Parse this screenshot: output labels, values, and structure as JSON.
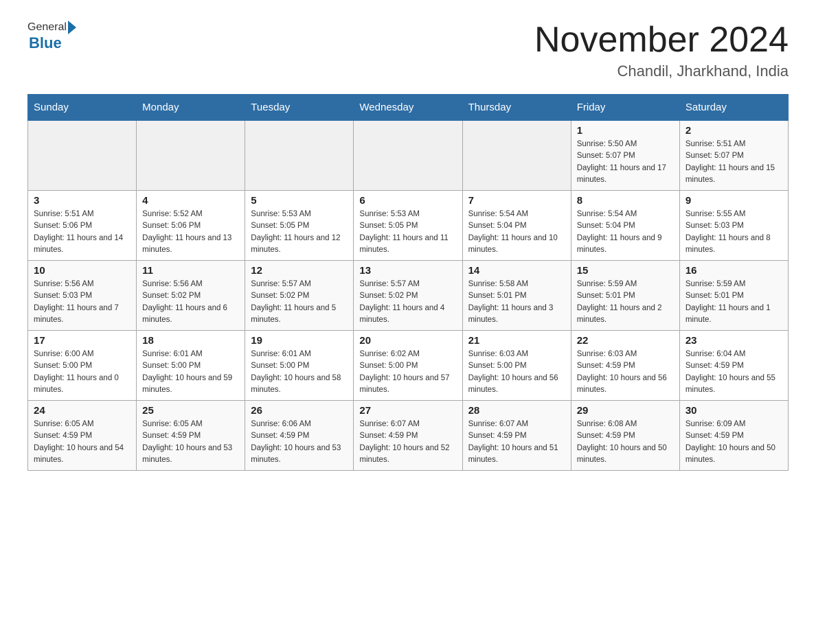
{
  "header": {
    "logo_general": "General",
    "logo_blue": "Blue",
    "title": "November 2024",
    "location": "Chandil, Jharkhand, India"
  },
  "days_of_week": [
    "Sunday",
    "Monday",
    "Tuesday",
    "Wednesday",
    "Thursday",
    "Friday",
    "Saturday"
  ],
  "weeks": [
    [
      {
        "day": "",
        "info": ""
      },
      {
        "day": "",
        "info": ""
      },
      {
        "day": "",
        "info": ""
      },
      {
        "day": "",
        "info": ""
      },
      {
        "day": "",
        "info": ""
      },
      {
        "day": "1",
        "info": "Sunrise: 5:50 AM\nSunset: 5:07 PM\nDaylight: 11 hours and 17 minutes."
      },
      {
        "day": "2",
        "info": "Sunrise: 5:51 AM\nSunset: 5:07 PM\nDaylight: 11 hours and 15 minutes."
      }
    ],
    [
      {
        "day": "3",
        "info": "Sunrise: 5:51 AM\nSunset: 5:06 PM\nDaylight: 11 hours and 14 minutes."
      },
      {
        "day": "4",
        "info": "Sunrise: 5:52 AM\nSunset: 5:06 PM\nDaylight: 11 hours and 13 minutes."
      },
      {
        "day": "5",
        "info": "Sunrise: 5:53 AM\nSunset: 5:05 PM\nDaylight: 11 hours and 12 minutes."
      },
      {
        "day": "6",
        "info": "Sunrise: 5:53 AM\nSunset: 5:05 PM\nDaylight: 11 hours and 11 minutes."
      },
      {
        "day": "7",
        "info": "Sunrise: 5:54 AM\nSunset: 5:04 PM\nDaylight: 11 hours and 10 minutes."
      },
      {
        "day": "8",
        "info": "Sunrise: 5:54 AM\nSunset: 5:04 PM\nDaylight: 11 hours and 9 minutes."
      },
      {
        "day": "9",
        "info": "Sunrise: 5:55 AM\nSunset: 5:03 PM\nDaylight: 11 hours and 8 minutes."
      }
    ],
    [
      {
        "day": "10",
        "info": "Sunrise: 5:56 AM\nSunset: 5:03 PM\nDaylight: 11 hours and 7 minutes."
      },
      {
        "day": "11",
        "info": "Sunrise: 5:56 AM\nSunset: 5:02 PM\nDaylight: 11 hours and 6 minutes."
      },
      {
        "day": "12",
        "info": "Sunrise: 5:57 AM\nSunset: 5:02 PM\nDaylight: 11 hours and 5 minutes."
      },
      {
        "day": "13",
        "info": "Sunrise: 5:57 AM\nSunset: 5:02 PM\nDaylight: 11 hours and 4 minutes."
      },
      {
        "day": "14",
        "info": "Sunrise: 5:58 AM\nSunset: 5:01 PM\nDaylight: 11 hours and 3 minutes."
      },
      {
        "day": "15",
        "info": "Sunrise: 5:59 AM\nSunset: 5:01 PM\nDaylight: 11 hours and 2 minutes."
      },
      {
        "day": "16",
        "info": "Sunrise: 5:59 AM\nSunset: 5:01 PM\nDaylight: 11 hours and 1 minute."
      }
    ],
    [
      {
        "day": "17",
        "info": "Sunrise: 6:00 AM\nSunset: 5:00 PM\nDaylight: 11 hours and 0 minutes."
      },
      {
        "day": "18",
        "info": "Sunrise: 6:01 AM\nSunset: 5:00 PM\nDaylight: 10 hours and 59 minutes."
      },
      {
        "day": "19",
        "info": "Sunrise: 6:01 AM\nSunset: 5:00 PM\nDaylight: 10 hours and 58 minutes."
      },
      {
        "day": "20",
        "info": "Sunrise: 6:02 AM\nSunset: 5:00 PM\nDaylight: 10 hours and 57 minutes."
      },
      {
        "day": "21",
        "info": "Sunrise: 6:03 AM\nSunset: 5:00 PM\nDaylight: 10 hours and 56 minutes."
      },
      {
        "day": "22",
        "info": "Sunrise: 6:03 AM\nSunset: 4:59 PM\nDaylight: 10 hours and 56 minutes."
      },
      {
        "day": "23",
        "info": "Sunrise: 6:04 AM\nSunset: 4:59 PM\nDaylight: 10 hours and 55 minutes."
      }
    ],
    [
      {
        "day": "24",
        "info": "Sunrise: 6:05 AM\nSunset: 4:59 PM\nDaylight: 10 hours and 54 minutes."
      },
      {
        "day": "25",
        "info": "Sunrise: 6:05 AM\nSunset: 4:59 PM\nDaylight: 10 hours and 53 minutes."
      },
      {
        "day": "26",
        "info": "Sunrise: 6:06 AM\nSunset: 4:59 PM\nDaylight: 10 hours and 53 minutes."
      },
      {
        "day": "27",
        "info": "Sunrise: 6:07 AM\nSunset: 4:59 PM\nDaylight: 10 hours and 52 minutes."
      },
      {
        "day": "28",
        "info": "Sunrise: 6:07 AM\nSunset: 4:59 PM\nDaylight: 10 hours and 51 minutes."
      },
      {
        "day": "29",
        "info": "Sunrise: 6:08 AM\nSunset: 4:59 PM\nDaylight: 10 hours and 50 minutes."
      },
      {
        "day": "30",
        "info": "Sunrise: 6:09 AM\nSunset: 4:59 PM\nDaylight: 10 hours and 50 minutes."
      }
    ]
  ]
}
